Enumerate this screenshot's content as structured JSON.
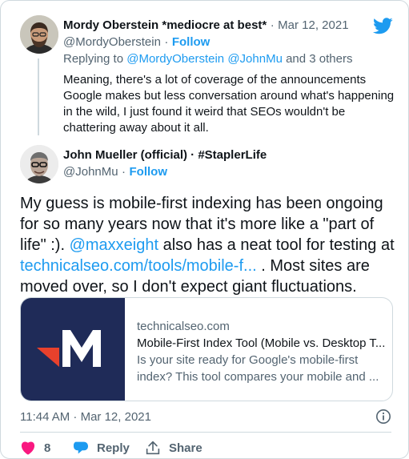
{
  "reply_tweet": {
    "display_name": "Mordy Oberstein *mediocre at best*",
    "separator": "·",
    "date": "Mar 12, 2021",
    "handle": "@MordyOberstein",
    "follow_label": "Follow",
    "replying_prefix": "Replying to",
    "replying_user1": "@MordyOberstein",
    "replying_user2": "@JohnMu",
    "replying_suffix": "and 3 others",
    "text_lines": [
      "Meaning, there's a lot of coverage of the announcements",
      "Google makes but less conversation around what's happening",
      "in the wild, I just found it weird that SEOs wouldn't be",
      "chattering away about it all."
    ]
  },
  "main_tweet": {
    "display_name": "John Mueller (official) · #StaplerLife",
    "handle": "@JohnMu",
    "separator": "·",
    "follow_label": "Follow",
    "line1": "My guess is mobile-first indexing has been ongoing",
    "line2": "for so many years now that it's more like a \"part of",
    "line3a": "life\" :).",
    "line3_mention": "@maxxeight",
    "line3b": "also has a neat tool for testing at",
    "line4_link": "technicalseo.com/tools/mobile-f...",
    "line4b": ". Most sites are",
    "line5": "moved over, so I don't expect giant fluctuations.",
    "timestamp": "11:44 AM · Mar 12, 2021"
  },
  "link_card": {
    "domain": "technicalseo.com",
    "title": "Mobile-First Index Tool (Mobile vs. Desktop T...",
    "desc_line1": "Is your site ready for Google's mobile-first",
    "desc_line2": "index? This tool compares your mobile and ..."
  },
  "actions": {
    "like_count": "8",
    "reply_label": "Reply",
    "share_label": "Share"
  },
  "colors": {
    "accent": "#1d9bf0",
    "like": "#f91880",
    "secondary_text": "#536471",
    "border": "#cfd9de",
    "card_thumb_bg": "#1f2b58",
    "logo_red": "#e8412c"
  },
  "icons": [
    "twitter-bird-icon",
    "info-icon",
    "heart-icon",
    "reply-icon",
    "share-icon"
  ]
}
